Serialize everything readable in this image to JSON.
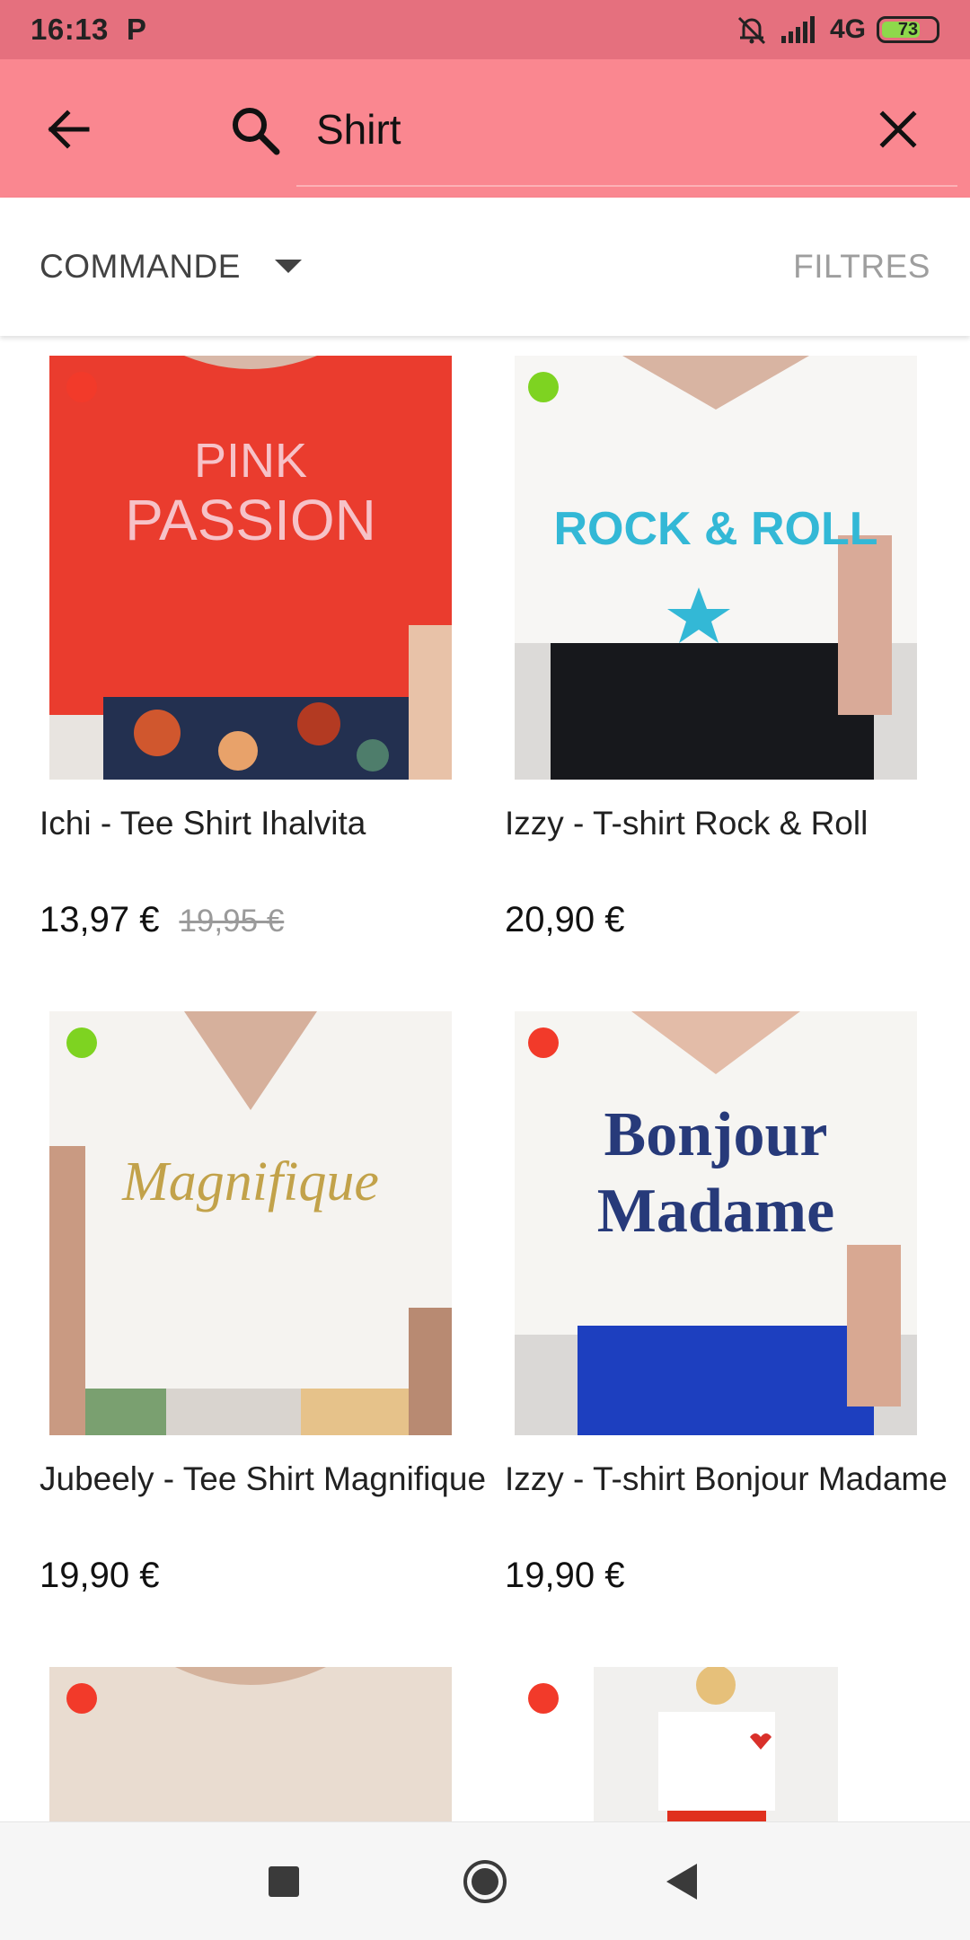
{
  "status_bar": {
    "time": "16:13",
    "carrier_icon": "P",
    "network": "4G",
    "battery_level": "73",
    "battery_fraction": 0.73,
    "icons": [
      "mute-icon",
      "signal-icon",
      "battery-icon"
    ]
  },
  "search": {
    "query": "Shirt",
    "back_icon": "arrow-back-icon",
    "search_icon": "search-icon",
    "clear_icon": "close-icon",
    "accent_color": "#fa8790"
  },
  "toolbar": {
    "sort_label": "COMMANDE",
    "filter_label": "FILTRES"
  },
  "products": [
    {
      "title": "Ichi - Tee Shirt Ihalvita",
      "price": "13,97 €",
      "old_price": "19,95 €",
      "availability_color": "#f23a2a",
      "image_text": [
        "PINK",
        "PASSION"
      ]
    },
    {
      "title": "Izzy - T-shirt Rock & Roll",
      "price": "20,90 €",
      "old_price": "",
      "availability_color": "#7ed321",
      "image_text": [
        "ROCK & ROLL"
      ]
    },
    {
      "title": "Jubeely - Tee Shirt Magnifique",
      "price": "19,90 €",
      "old_price": "",
      "availability_color": "#7ed321",
      "image_text": [
        "Magnifique"
      ]
    },
    {
      "title": "Izzy - T-shirt Bonjour Madame",
      "price": "19,90 €",
      "old_price": "",
      "availability_color": "#f23a2a",
      "image_text": [
        "Bonjour",
        "Madame"
      ]
    },
    {
      "title": "",
      "price": "",
      "old_price": "",
      "availability_color": "#f23a2a",
      "image_text": []
    },
    {
      "title": "",
      "price": "",
      "old_price": "",
      "availability_color": "#f23a2a",
      "image_text": []
    }
  ],
  "nav": {
    "icons": [
      "recents-square-icon",
      "home-circle-icon",
      "back-triangle-icon"
    ]
  }
}
